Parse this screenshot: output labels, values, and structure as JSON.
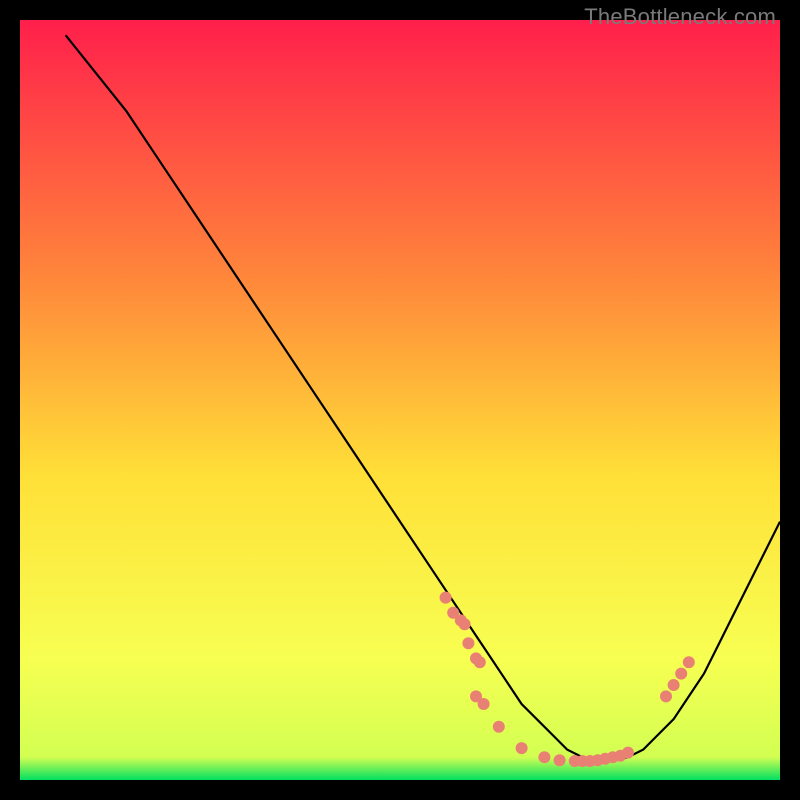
{
  "watermark": "TheBottleneck.com",
  "colors": {
    "page_bg": "#000000",
    "gradient_top": "#ff1f4b",
    "gradient_mid_upper": "#ff8a3a",
    "gradient_mid": "#ffe038",
    "gradient_lower": "#f7ff52",
    "gradient_bottom": "#00e060",
    "curve": "#000000",
    "dot": "#e98074"
  },
  "chart_data": {
    "type": "line",
    "title": "",
    "xlabel": "",
    "ylabel": "",
    "xlim": [
      0,
      100
    ],
    "ylim": [
      0,
      100
    ],
    "series": [
      {
        "name": "bottleneck-curve",
        "x": [
          6,
          10,
          14,
          18,
          22,
          26,
          30,
          34,
          38,
          42,
          46,
          50,
          54,
          58,
          60,
          62,
          64,
          66,
          68,
          70,
          72,
          74,
          76,
          78,
          80,
          82,
          84,
          86,
          88,
          90,
          92,
          94,
          96,
          98,
          100
        ],
        "y": [
          98,
          93,
          88,
          82,
          76,
          70,
          64,
          58,
          52,
          46,
          40,
          34,
          28,
          22,
          19,
          16,
          13,
          10,
          8,
          6,
          4,
          3,
          2.5,
          2.5,
          3,
          4,
          6,
          8,
          11,
          14,
          18,
          22,
          26,
          30,
          34
        ]
      }
    ],
    "cluster_left": {
      "x": [
        56,
        57,
        58,
        58.5,
        59,
        60,
        60.5
      ],
      "y": [
        24,
        22,
        21,
        20.5,
        18,
        16,
        15.5
      ]
    },
    "cluster_bottom": {
      "x": [
        60,
        61,
        63,
        66,
        69,
        71,
        73,
        74,
        75,
        76,
        77,
        78,
        79,
        80
      ],
      "y": [
        11,
        10,
        7,
        4.2,
        3,
        2.6,
        2.5,
        2.5,
        2.5,
        2.6,
        2.8,
        3.0,
        3.2,
        3.6
      ]
    },
    "cluster_right": {
      "x": [
        85,
        86,
        87,
        88
      ],
      "y": [
        11,
        12.5,
        14,
        15.5
      ]
    }
  }
}
